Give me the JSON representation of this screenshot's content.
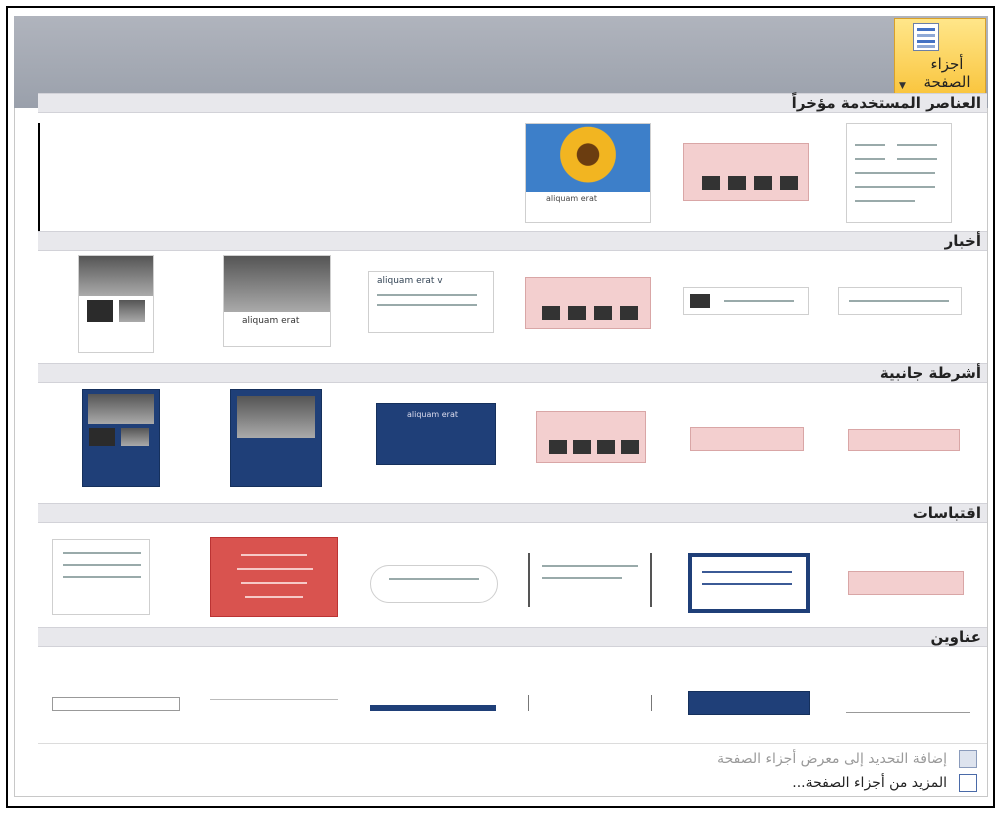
{
  "ribbon": {
    "page_parts_button": {
      "label": "أجزاء الصفحة",
      "icon": "page-parts-icon"
    }
  },
  "gallery": {
    "sections": [
      {
        "key": "recent",
        "title": "العناصر المستخدمة مؤخراً",
        "count": 4
      },
      {
        "key": "news",
        "title": "أخبار",
        "count": 6
      },
      {
        "key": "sidebars",
        "title": "أشرطة جانبية",
        "count": 6
      },
      {
        "key": "quotes",
        "title": "اقتباسات",
        "count": 6
      },
      {
        "key": "headings",
        "title": "عناوين",
        "count": 6
      }
    ]
  },
  "thumb_text": {
    "aliquam": "aliquam erat",
    "aliquam_v": "aliquam erat v"
  },
  "footer": {
    "add_selection": {
      "label": "إضافة التحديد إلى معرض أجزاء الصفحة",
      "icon": "add-to-gallery-icon"
    },
    "more_parts": {
      "label": "المزيد من أجزاء الصفحة...",
      "icon": "more-page-parts-icon"
    }
  },
  "colors": {
    "accent_gold": "#f9c43b",
    "navy": "#1f3f78",
    "pink": "#f3cfcf",
    "red": "#d9534f"
  }
}
